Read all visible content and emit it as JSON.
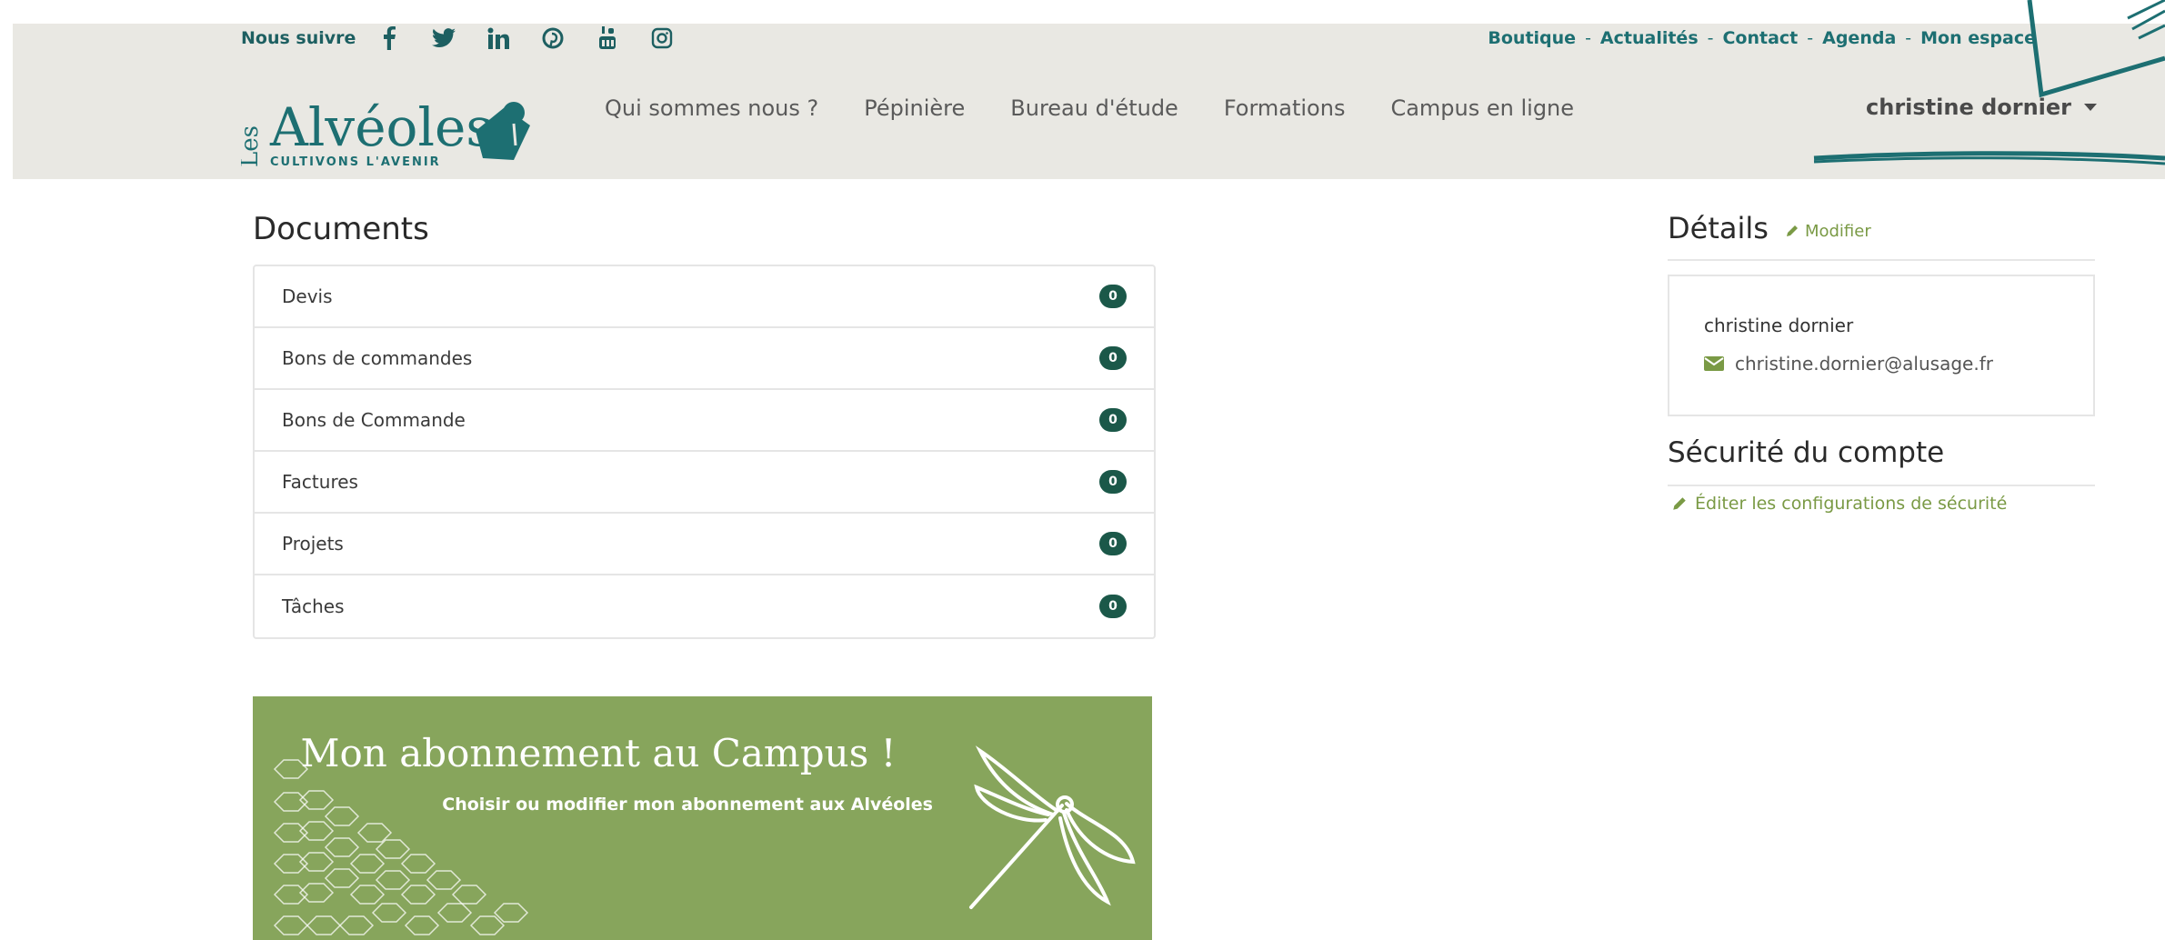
{
  "header": {
    "follow_label": "Nous suivre",
    "social": [
      "facebook-icon",
      "twitter-icon",
      "linkedin-icon",
      "pinterest-icon",
      "youtube-icon",
      "instagram-icon"
    ],
    "top_links": [
      "Boutique",
      "Actualités",
      "Contact",
      "Agenda",
      "Mon espace"
    ],
    "logo": {
      "les": "Les",
      "name": "Alvéoles",
      "tagline": "CULTIVONS L'AVENIR"
    },
    "nav": [
      "Qui sommes nous ?",
      "Pépinière",
      "Bureau d'étude",
      "Formations",
      "Campus en ligne"
    ],
    "user_name": "christine dornier"
  },
  "documents": {
    "title": "Documents",
    "rows": [
      {
        "label": "Devis",
        "count": "0"
      },
      {
        "label": "Bons de commandes",
        "count": "0"
      },
      {
        "label": "Bons de Commande",
        "count": "0"
      },
      {
        "label": "Factures",
        "count": "0"
      },
      {
        "label": "Projets",
        "count": "0"
      },
      {
        "label": "Tâches",
        "count": "0"
      }
    ]
  },
  "banner": {
    "title": "Mon abonnement au Campus !",
    "subtitle": "Choisir ou modifier mon abonnement aux Alvéoles"
  },
  "details": {
    "title": "Détails",
    "modify_label": "Modifier",
    "name": "christine dornier",
    "email": "christine.dornier@alusage.fr"
  },
  "security": {
    "title": "Sécurité du compte",
    "edit_label": "Éditer les configurations de sécurité"
  },
  "colors": {
    "brand": "#1d6f72",
    "badge": "#1b5849",
    "banner": "#87a55c",
    "accent_link": "#7a9a45",
    "header_bg": "#e9e8e3"
  }
}
